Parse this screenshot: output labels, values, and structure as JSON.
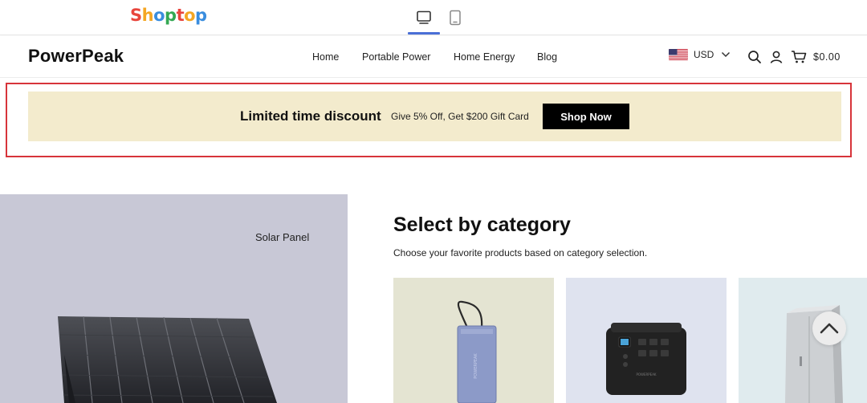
{
  "editor": {
    "brand_letters": [
      {
        "ch": "S",
        "color": "#e8453c"
      },
      {
        "ch": "h",
        "color": "#f4a623"
      },
      {
        "ch": "o",
        "color": "#3a8dde"
      },
      {
        "ch": "p",
        "color": "#34a853"
      },
      {
        "ch": "t",
        "color": "#e8453c"
      },
      {
        "ch": "o",
        "color": "#f4a623"
      },
      {
        "ch": "p",
        "color": "#3a8dde"
      }
    ],
    "devices": [
      "desktop-icon",
      "tablet-icon"
    ],
    "active_device": "desktop",
    "accent": "#4a6fd6"
  },
  "store": {
    "logo": "PowerPeak",
    "nav": [
      "Home",
      "Portable Power",
      "Home Energy",
      "Blog"
    ],
    "currency": "USD",
    "cart_total": "$0.00",
    "icons": [
      "search-icon",
      "account-icon",
      "cart-icon",
      "chevron-down-icon",
      "us-flag-icon"
    ]
  },
  "announcement": {
    "title": "Limited time discount",
    "subtitle": "Give 5% Off, Get $200 Gift Card",
    "button": "Shop Now",
    "background": "#f3ebcd",
    "highlight_border": "#d7343a"
  },
  "hero": {
    "label": "Solar Panel",
    "background": "#c8c8d6"
  },
  "category": {
    "title": "Select by category",
    "subtitle": "Choose your favorite products based on category selection.",
    "cards": [
      {
        "name": "power-bank-product",
        "background": "#e4e4d2"
      },
      {
        "name": "power-station-product",
        "background": "#dfe3ef"
      },
      {
        "name": "energy-cabinet-product",
        "background": "#e0ebee"
      }
    ]
  },
  "scroll_top_icon": "chevron-up-icon"
}
